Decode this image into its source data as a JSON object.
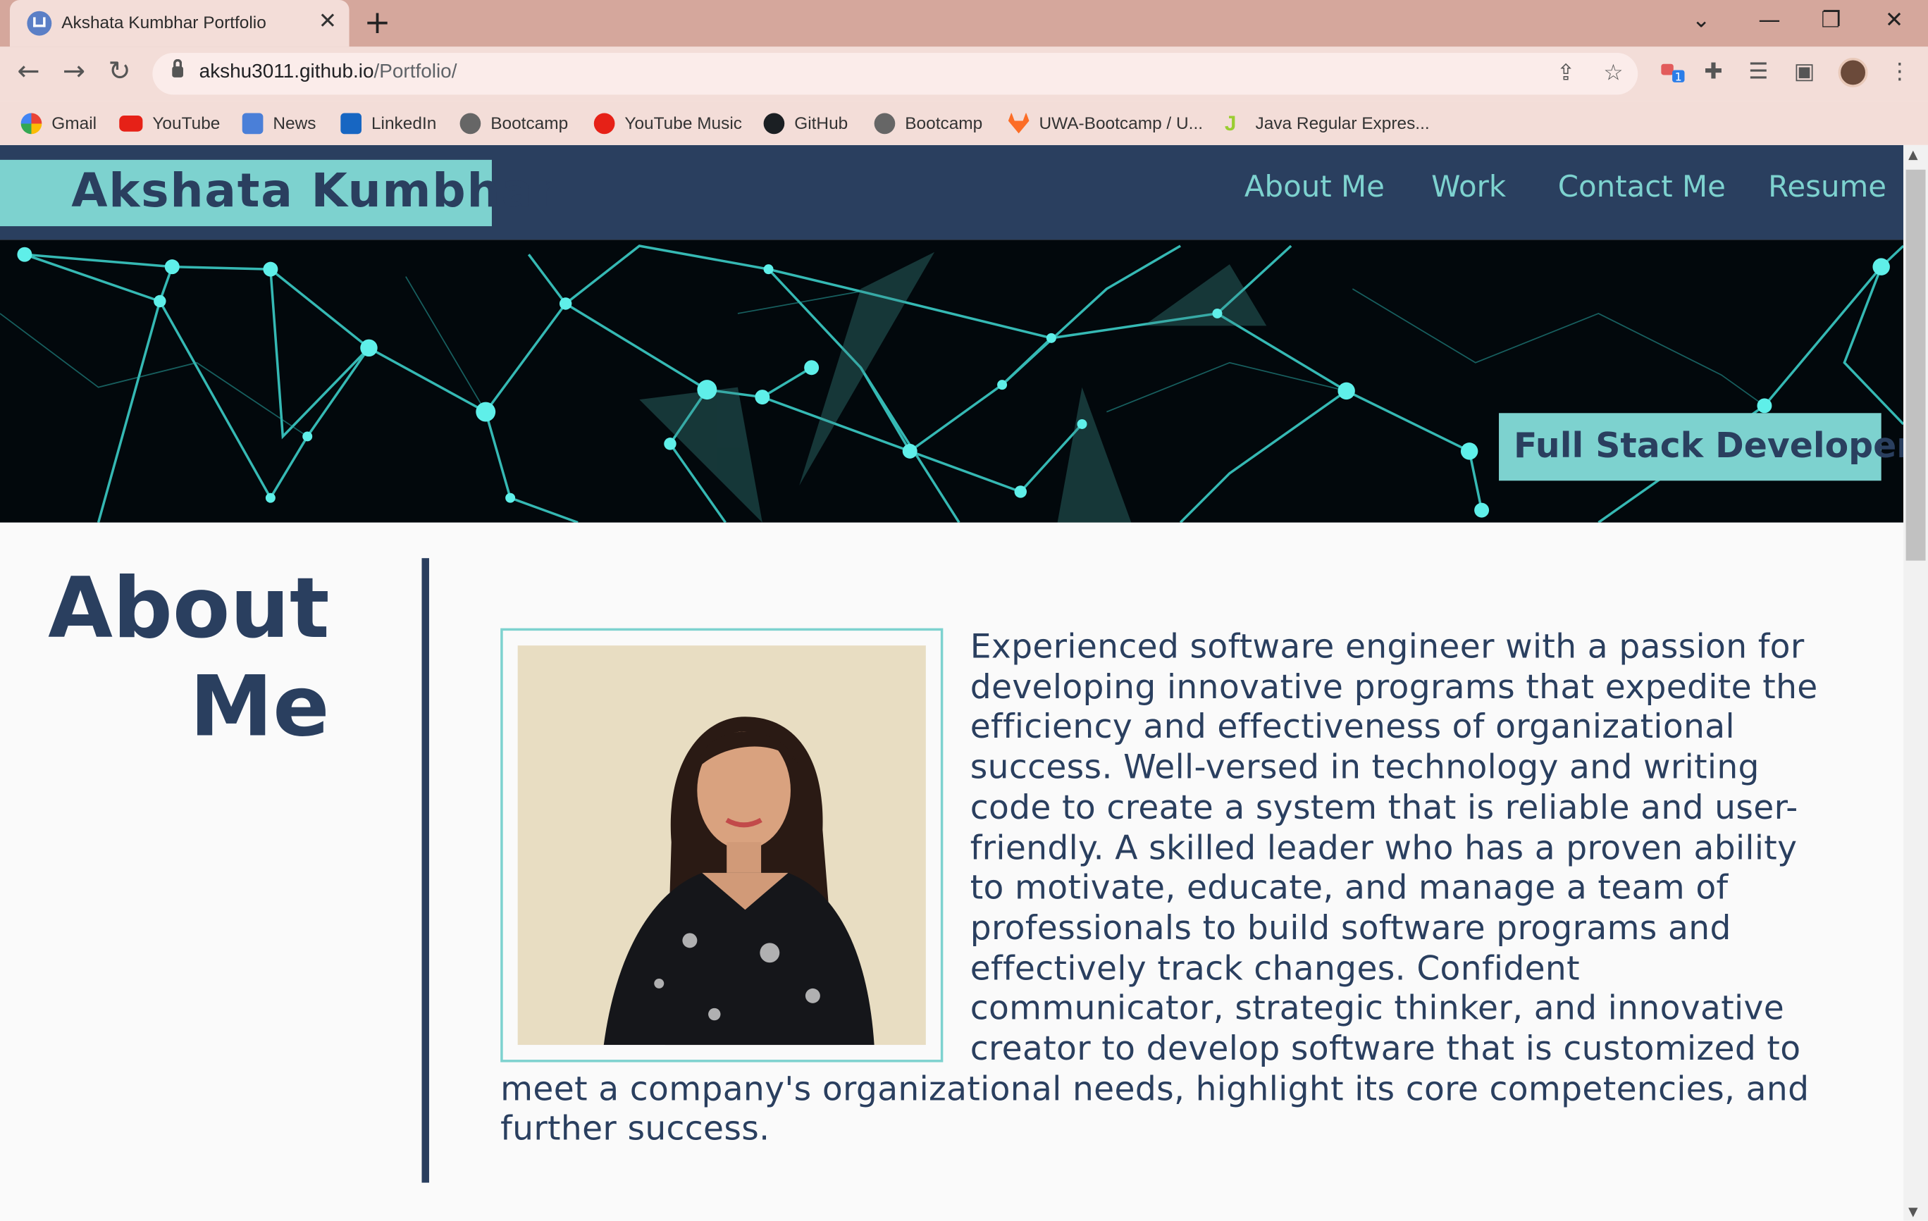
{
  "browser": {
    "tab_title": "Akshata Kumbhar Portfolio",
    "url_host": "akshu3011.github.io",
    "url_path": "/Portfolio/",
    "bookmarks": [
      {
        "label": "Gmail",
        "icon": "google-icon"
      },
      {
        "label": "YouTube",
        "icon": "youtube-icon"
      },
      {
        "label": "News",
        "icon": "news-icon"
      },
      {
        "label": "LinkedIn",
        "icon": "linkedin-icon"
      },
      {
        "label": "Bootcamp",
        "icon": "globe-icon"
      },
      {
        "label": "YouTube Music",
        "icon": "youtube-music-icon"
      },
      {
        "label": "GitHub",
        "icon": "github-icon"
      },
      {
        "label": "Bootcamp",
        "icon": "globe-icon"
      },
      {
        "label": "UWA-Bootcamp / U...",
        "icon": "gitlab-icon"
      },
      {
        "label": "Java Regular Expres...",
        "icon": "j-icon"
      }
    ],
    "extension_badge": "1"
  },
  "site": {
    "brand": "Akshata Kumbhar",
    "nav": [
      "About Me",
      "Work",
      "Contact Me",
      "Resume"
    ],
    "role": "Full Stack Developer",
    "about_title_line1": "About",
    "about_title_line2": "Me",
    "bio": "Experienced software engineer with a passion for developing innovative programs that expedite the efficiency and effectiveness of organizational success. Well-versed in technology and writing code to create a system that is reliable and user-friendly. A skilled leader who has a proven ability to motivate, educate, and manage a team of professionals to build software programs and effectively track changes. Confident communicator, strategic thinker, and innovative creator to develop software that is customized to meet a company's organizational needs, highlight its core competencies, and further success."
  },
  "colors": {
    "navy": "#2a3f5f",
    "teal": "#7dd2cf",
    "chrome_tab": "#d5a79c",
    "chrome_bar": "#f3ddd8"
  }
}
